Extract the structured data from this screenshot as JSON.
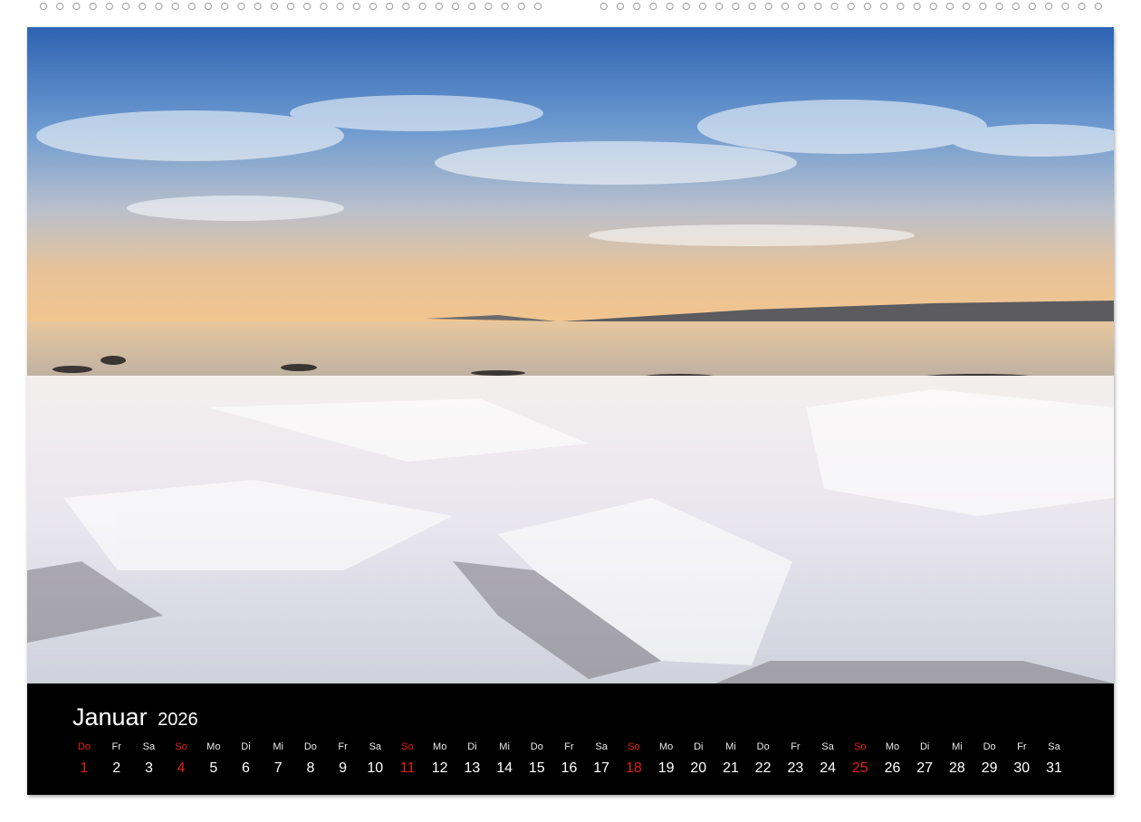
{
  "calendar": {
    "month": "Januar",
    "year": "2026",
    "days": [
      {
        "wd": "Do",
        "d": "1",
        "sun": true
      },
      {
        "wd": "Fr",
        "d": "2",
        "sun": false
      },
      {
        "wd": "Sa",
        "d": "3",
        "sun": false
      },
      {
        "wd": "So",
        "d": "4",
        "sun": true
      },
      {
        "wd": "Mo",
        "d": "5",
        "sun": false
      },
      {
        "wd": "Di",
        "d": "6",
        "sun": false
      },
      {
        "wd": "Mi",
        "d": "7",
        "sun": false
      },
      {
        "wd": "Do",
        "d": "8",
        "sun": false
      },
      {
        "wd": "Fr",
        "d": "9",
        "sun": false
      },
      {
        "wd": "Sa",
        "d": "10",
        "sun": false
      },
      {
        "wd": "So",
        "d": "11",
        "sun": true
      },
      {
        "wd": "Mo",
        "d": "12",
        "sun": false
      },
      {
        "wd": "Di",
        "d": "13",
        "sun": false
      },
      {
        "wd": "Mi",
        "d": "14",
        "sun": false
      },
      {
        "wd": "Do",
        "d": "15",
        "sun": false
      },
      {
        "wd": "Fr",
        "d": "16",
        "sun": false
      },
      {
        "wd": "Sa",
        "d": "17",
        "sun": false
      },
      {
        "wd": "So",
        "d": "18",
        "sun": true
      },
      {
        "wd": "Mo",
        "d": "19",
        "sun": false
      },
      {
        "wd": "Di",
        "d": "20",
        "sun": false
      },
      {
        "wd": "Mi",
        "d": "21",
        "sun": false
      },
      {
        "wd": "Do",
        "d": "22",
        "sun": false
      },
      {
        "wd": "Fr",
        "d": "23",
        "sun": false
      },
      {
        "wd": "Sa",
        "d": "24",
        "sun": false
      },
      {
        "wd": "So",
        "d": "25",
        "sun": true
      },
      {
        "wd": "Mo",
        "d": "26",
        "sun": false
      },
      {
        "wd": "Di",
        "d": "27",
        "sun": false
      },
      {
        "wd": "Mi",
        "d": "28",
        "sun": false
      },
      {
        "wd": "Do",
        "d": "29",
        "sun": false
      },
      {
        "wd": "Fr",
        "d": "30",
        "sun": false
      },
      {
        "wd": "Sa",
        "d": "31",
        "sun": false
      }
    ]
  },
  "colors": {
    "sunday": "#e2201a",
    "text": "#ffffff",
    "background": "#000000"
  }
}
